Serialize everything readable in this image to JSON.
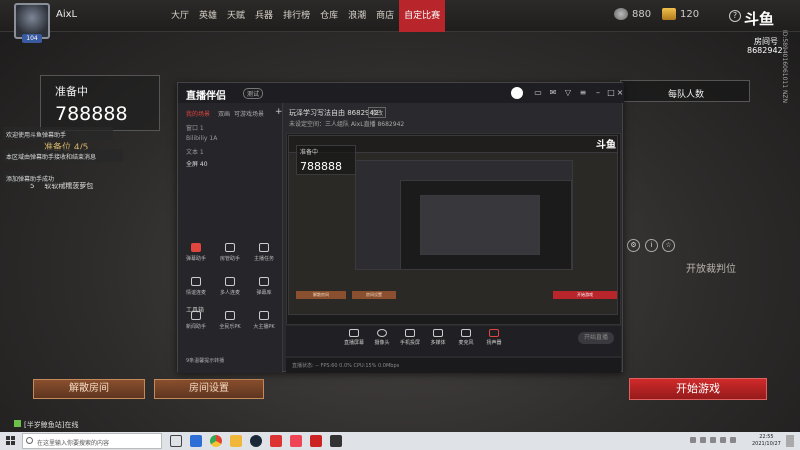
{
  "user": {
    "name": "AixL",
    "level": "104"
  },
  "nav": [
    {
      "label": "大厅"
    },
    {
      "label": "英雄"
    },
    {
      "label": "天赋"
    },
    {
      "label": "兵器"
    },
    {
      "label": "排行榜"
    },
    {
      "label": "仓库"
    },
    {
      "label": "浪潮"
    },
    {
      "label": "商店"
    },
    {
      "label": "自定比赛",
      "active": true
    }
  ],
  "currency": {
    "coins": "880",
    "gold": "120"
  },
  "douyu": {
    "logo": "斗鱼",
    "room_label": "房间号",
    "room_number": "8682942"
  },
  "side_id": "ID:5894016061011 NZN",
  "lobby": {
    "status": "准备中",
    "room": "788888",
    "ready": "准备位 4/5",
    "player5": {
      "num": "5",
      "name": "软软糯糯菠萝包"
    },
    "notices": [
      "欢迎使用斗鱼弹幕助手",
      "本区域由弹幕助手接收和结束消息",
      "添加弹幕助手成功"
    ]
  },
  "team": {
    "header": "每队人数",
    "judge_label": "开放裁判位"
  },
  "buttons": {
    "disband": "解散房间",
    "settings": "房间设置",
    "start": "开始游戏"
  },
  "friend_status": "[半岁鲸鱼站]在线",
  "stream_app": {
    "logo": "直播伴侣",
    "version": "测试",
    "tabs": [
      "我的场景",
      "双画",
      "可游戏",
      "场景"
    ],
    "scenes": [
      "窗口 1",
      "Bilibiliy 1A",
      "文本 1",
      "全屏 40"
    ],
    "tools_title": "工具箱",
    "tools": [
      {
        "label": "弹幕助手"
      },
      {
        "label": "房管助手"
      },
      {
        "label": "主播任务"
      },
      {
        "label": "情谊连麦"
      },
      {
        "label": "多人连麦"
      },
      {
        "label": "弹幕库"
      },
      {
        "label": "新闻助手"
      },
      {
        "label": "全民乐PK"
      },
      {
        "label": "大主播PK"
      }
    ],
    "stream_title": "玩泽学习写法自由 8682942",
    "badge": "修改",
    "meta": "未设定空间：三人组队   AixL直播   8682942",
    "bottom_tools": [
      {
        "label": "直播屏幕"
      },
      {
        "label": "摄像头"
      },
      {
        "label": "手机投屏"
      },
      {
        "label": "多媒体"
      },
      {
        "label": "麦克风"
      },
      {
        "label": "扬声器"
      }
    ],
    "start_live": "开始直播",
    "hint": "9条温馨提示转播",
    "status": "直播状态: -- FPS:60  0.0%  CPU:15%  0.0Mbps"
  },
  "nested": {
    "room": "788888",
    "status": "准备中",
    "btn_disband": "解散房间",
    "btn_settings": "房间设置",
    "btn_start": "开始游戏"
  },
  "taskbar": {
    "search_placeholder": "在这里输入你要搜索的内容",
    "time": "22:55",
    "date": "2021/10/27"
  }
}
